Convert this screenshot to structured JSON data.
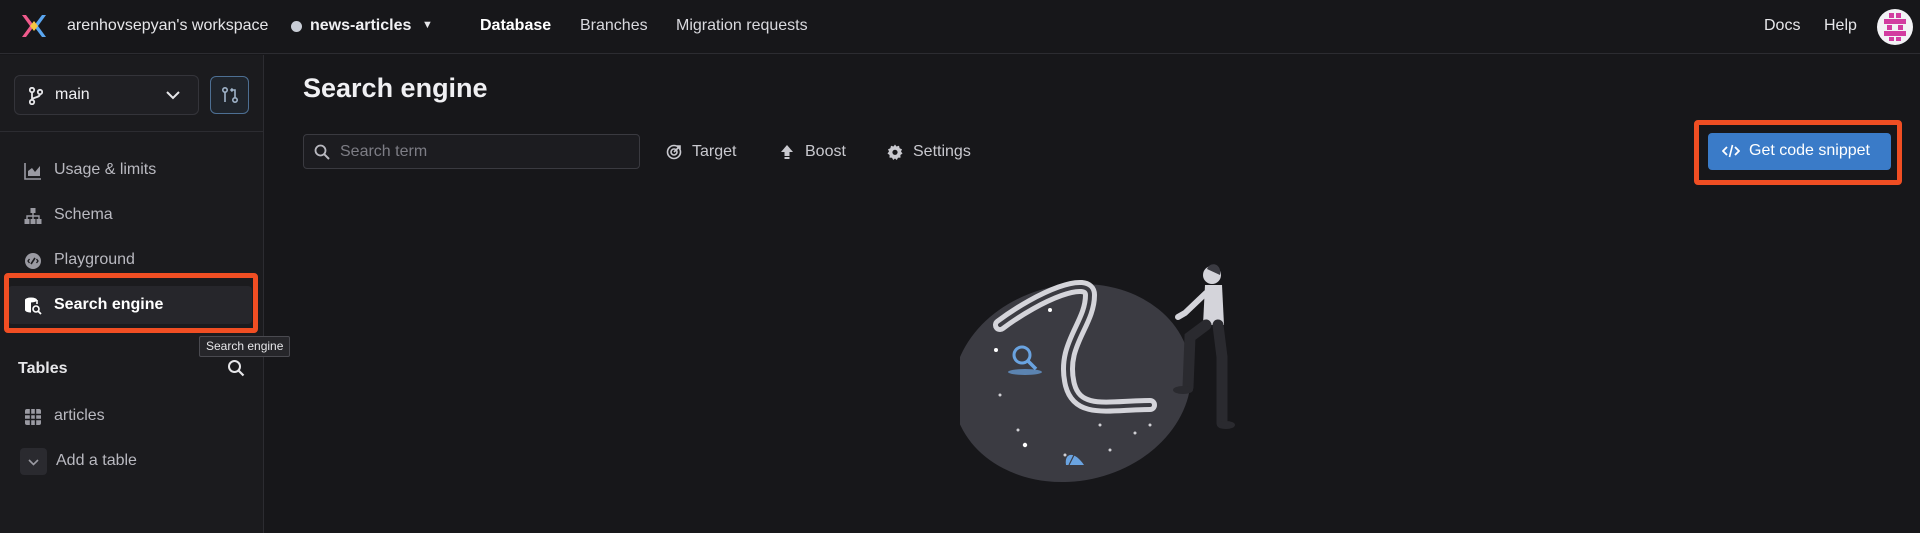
{
  "topbar": {
    "workspace": "arenhovsepyan's workspace",
    "database": "news-articles",
    "nav": [
      "Database",
      "Branches",
      "Migration requests"
    ],
    "active_nav": "Database",
    "docs": "Docs",
    "help": "Help"
  },
  "sidebar": {
    "branch": "main",
    "items": [
      {
        "label": "Usage & limits",
        "icon": "chart-icon"
      },
      {
        "label": "Schema",
        "icon": "schema-icon"
      },
      {
        "label": "Playground",
        "icon": "code-icon"
      },
      {
        "label": "Search engine",
        "icon": "search-database-icon",
        "active": true
      }
    ],
    "tooltip": "Search engine",
    "tables_heading": "Tables",
    "tables": [
      {
        "label": "articles",
        "icon": "table-grid-icon"
      }
    ],
    "add_table": "Add a table"
  },
  "main": {
    "title": "Search engine",
    "search_placeholder": "Search term",
    "search_value": "",
    "tools": [
      {
        "label": "Target",
        "icon": "target-icon"
      },
      {
        "label": "Boost",
        "icon": "boost-icon"
      },
      {
        "label": "Settings",
        "icon": "gear-icon"
      }
    ],
    "snippet_button": "Get code snippet"
  },
  "colors": {
    "accent": "#3a7bc8",
    "highlight": "#f04e23",
    "background": "#17171a"
  }
}
